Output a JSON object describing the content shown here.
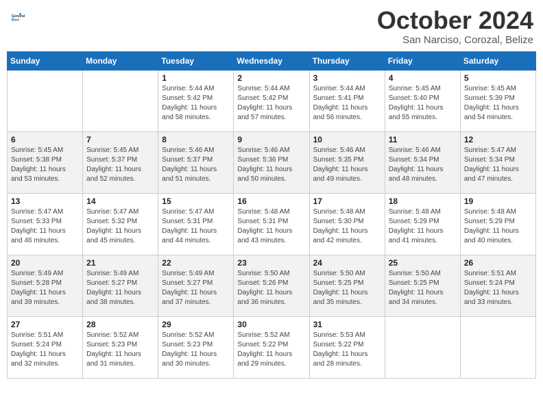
{
  "logo": {
    "general": "General",
    "blue": "Blue"
  },
  "title": "October 2024",
  "location": "San Narciso, Corozal, Belize",
  "days_of_week": [
    "Sunday",
    "Monday",
    "Tuesday",
    "Wednesday",
    "Thursday",
    "Friday",
    "Saturday"
  ],
  "weeks": [
    [
      {
        "day": "",
        "sunrise": "",
        "sunset": "",
        "daylight": ""
      },
      {
        "day": "",
        "sunrise": "",
        "sunset": "",
        "daylight": ""
      },
      {
        "day": "1",
        "sunrise": "Sunrise: 5:44 AM",
        "sunset": "Sunset: 5:42 PM",
        "daylight": "Daylight: 11 hours and 58 minutes."
      },
      {
        "day": "2",
        "sunrise": "Sunrise: 5:44 AM",
        "sunset": "Sunset: 5:42 PM",
        "daylight": "Daylight: 11 hours and 57 minutes."
      },
      {
        "day": "3",
        "sunrise": "Sunrise: 5:44 AM",
        "sunset": "Sunset: 5:41 PM",
        "daylight": "Daylight: 11 hours and 56 minutes."
      },
      {
        "day": "4",
        "sunrise": "Sunrise: 5:45 AM",
        "sunset": "Sunset: 5:40 PM",
        "daylight": "Daylight: 11 hours and 55 minutes."
      },
      {
        "day": "5",
        "sunrise": "Sunrise: 5:45 AM",
        "sunset": "Sunset: 5:39 PM",
        "daylight": "Daylight: 11 hours and 54 minutes."
      }
    ],
    [
      {
        "day": "6",
        "sunrise": "Sunrise: 5:45 AM",
        "sunset": "Sunset: 5:38 PM",
        "daylight": "Daylight: 11 hours and 53 minutes."
      },
      {
        "day": "7",
        "sunrise": "Sunrise: 5:45 AM",
        "sunset": "Sunset: 5:37 PM",
        "daylight": "Daylight: 11 hours and 52 minutes."
      },
      {
        "day": "8",
        "sunrise": "Sunrise: 5:46 AM",
        "sunset": "Sunset: 5:37 PM",
        "daylight": "Daylight: 11 hours and 51 minutes."
      },
      {
        "day": "9",
        "sunrise": "Sunrise: 5:46 AM",
        "sunset": "Sunset: 5:36 PM",
        "daylight": "Daylight: 11 hours and 50 minutes."
      },
      {
        "day": "10",
        "sunrise": "Sunrise: 5:46 AM",
        "sunset": "Sunset: 5:35 PM",
        "daylight": "Daylight: 11 hours and 49 minutes."
      },
      {
        "day": "11",
        "sunrise": "Sunrise: 5:46 AM",
        "sunset": "Sunset: 5:34 PM",
        "daylight": "Daylight: 11 hours and 48 minutes."
      },
      {
        "day": "12",
        "sunrise": "Sunrise: 5:47 AM",
        "sunset": "Sunset: 5:34 PM",
        "daylight": "Daylight: 11 hours and 47 minutes."
      }
    ],
    [
      {
        "day": "13",
        "sunrise": "Sunrise: 5:47 AM",
        "sunset": "Sunset: 5:33 PM",
        "daylight": "Daylight: 11 hours and 46 minutes."
      },
      {
        "day": "14",
        "sunrise": "Sunrise: 5:47 AM",
        "sunset": "Sunset: 5:32 PM",
        "daylight": "Daylight: 11 hours and 45 minutes."
      },
      {
        "day": "15",
        "sunrise": "Sunrise: 5:47 AM",
        "sunset": "Sunset: 5:31 PM",
        "daylight": "Daylight: 11 hours and 44 minutes."
      },
      {
        "day": "16",
        "sunrise": "Sunrise: 5:48 AM",
        "sunset": "Sunset: 5:31 PM",
        "daylight": "Daylight: 11 hours and 43 minutes."
      },
      {
        "day": "17",
        "sunrise": "Sunrise: 5:48 AM",
        "sunset": "Sunset: 5:30 PM",
        "daylight": "Daylight: 11 hours and 42 minutes."
      },
      {
        "day": "18",
        "sunrise": "Sunrise: 5:48 AM",
        "sunset": "Sunset: 5:29 PM",
        "daylight": "Daylight: 11 hours and 41 minutes."
      },
      {
        "day": "19",
        "sunrise": "Sunrise: 5:48 AM",
        "sunset": "Sunset: 5:29 PM",
        "daylight": "Daylight: 11 hours and 40 minutes."
      }
    ],
    [
      {
        "day": "20",
        "sunrise": "Sunrise: 5:49 AM",
        "sunset": "Sunset: 5:28 PM",
        "daylight": "Daylight: 11 hours and 39 minutes."
      },
      {
        "day": "21",
        "sunrise": "Sunrise: 5:49 AM",
        "sunset": "Sunset: 5:27 PM",
        "daylight": "Daylight: 11 hours and 38 minutes."
      },
      {
        "day": "22",
        "sunrise": "Sunrise: 5:49 AM",
        "sunset": "Sunset: 5:27 PM",
        "daylight": "Daylight: 11 hours and 37 minutes."
      },
      {
        "day": "23",
        "sunrise": "Sunrise: 5:50 AM",
        "sunset": "Sunset: 5:26 PM",
        "daylight": "Daylight: 11 hours and 36 minutes."
      },
      {
        "day": "24",
        "sunrise": "Sunrise: 5:50 AM",
        "sunset": "Sunset: 5:25 PM",
        "daylight": "Daylight: 11 hours and 35 minutes."
      },
      {
        "day": "25",
        "sunrise": "Sunrise: 5:50 AM",
        "sunset": "Sunset: 5:25 PM",
        "daylight": "Daylight: 11 hours and 34 minutes."
      },
      {
        "day": "26",
        "sunrise": "Sunrise: 5:51 AM",
        "sunset": "Sunset: 5:24 PM",
        "daylight": "Daylight: 11 hours and 33 minutes."
      }
    ],
    [
      {
        "day": "27",
        "sunrise": "Sunrise: 5:51 AM",
        "sunset": "Sunset: 5:24 PM",
        "daylight": "Daylight: 11 hours and 32 minutes."
      },
      {
        "day": "28",
        "sunrise": "Sunrise: 5:52 AM",
        "sunset": "Sunset: 5:23 PM",
        "daylight": "Daylight: 11 hours and 31 minutes."
      },
      {
        "day": "29",
        "sunrise": "Sunrise: 5:52 AM",
        "sunset": "Sunset: 5:23 PM",
        "daylight": "Daylight: 11 hours and 30 minutes."
      },
      {
        "day": "30",
        "sunrise": "Sunrise: 5:52 AM",
        "sunset": "Sunset: 5:22 PM",
        "daylight": "Daylight: 11 hours and 29 minutes."
      },
      {
        "day": "31",
        "sunrise": "Sunrise: 5:53 AM",
        "sunset": "Sunset: 5:22 PM",
        "daylight": "Daylight: 11 hours and 28 minutes."
      },
      {
        "day": "",
        "sunrise": "",
        "sunset": "",
        "daylight": ""
      },
      {
        "day": "",
        "sunrise": "",
        "sunset": "",
        "daylight": ""
      }
    ]
  ]
}
